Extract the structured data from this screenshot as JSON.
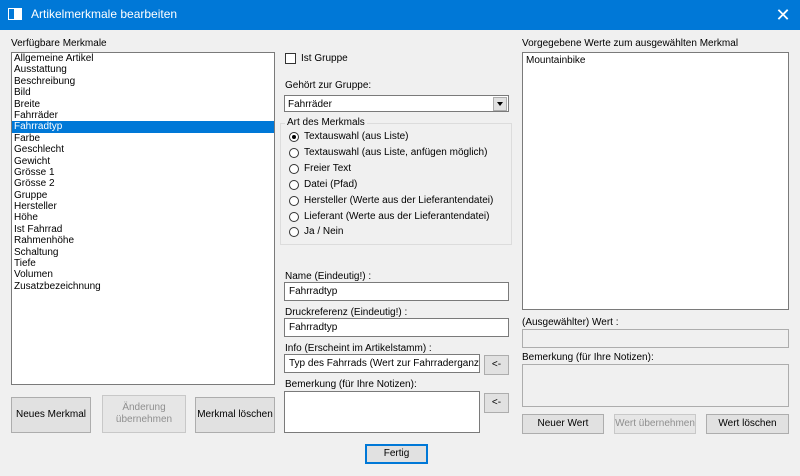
{
  "window": {
    "title": "Artikelmerkmale bearbeiten"
  },
  "left": {
    "label": "Verfügbare Merkmale",
    "items": [
      "Allgemeine Artikel",
      "Ausstattung",
      "Beschreibung",
      "Bild",
      "Breite",
      "Fahrräder",
      "Fahrradtyp",
      "Farbe",
      "Geschlecht",
      "Gewicht",
      "Grösse 1",
      "Grösse 2",
      "Gruppe",
      "Hersteller",
      "Höhe",
      "Ist Fahrrad",
      "Rahmenhöhe",
      "Schaltung",
      "Tiefe",
      "Volumen",
      "Zusatzbezeichnung"
    ],
    "selected": "Fahrradtyp",
    "btn_new": "Neues Merkmal",
    "btn_apply_line1": "Änderung",
    "btn_apply_line2": "übernehmen",
    "btn_delete": "Merkmal löschen"
  },
  "middle": {
    "is_group_label": "Ist Gruppe",
    "is_group_checked": false,
    "group_label": "Gehört zur Gruppe:",
    "group_value": "Fahrräder",
    "type_label": "Art des Merkmals",
    "types": [
      "Textauswahl (aus Liste)",
      "Textauswahl (aus Liste, anfügen möglich)",
      "Freier Text",
      "Datei (Pfad)",
      "Hersteller (Werte aus der Lieferantendatei)",
      "Lieferant (Werte aus der Lieferantendatei)",
      "Ja / Nein"
    ],
    "selected_type": "Textauswahl (aus Liste)",
    "name_label": "Name (Eindeutig!) :",
    "name_value": "Fahrradtyp",
    "print_label": "Druckreferenz (Eindeutig!) :",
    "print_value": "Fahrradtyp",
    "info_label": "Info (Erscheint im Artikelstamm) :",
    "info_value": "Typ des Fahrrads (Wert zur Fahrraderganzun",
    "remark_label": "Bemerkung (für Ihre Notizen):",
    "remark_value": "",
    "arrow_btn": "<-"
  },
  "right": {
    "values_label": "Vorgegebene Werte zum ausgewählten Merkmal",
    "values": [
      "Mountainbike"
    ],
    "value_label": "(Ausgewählter) Wert :",
    "value_value": "",
    "remark_label": "Bemerkung (für Ihre Notizen):",
    "remark_value": "",
    "btn_new": "Neuer Wert",
    "btn_apply": "Wert übernehmen",
    "btn_delete": "Wert löschen"
  },
  "footer": {
    "btn_done": "Fertig"
  }
}
